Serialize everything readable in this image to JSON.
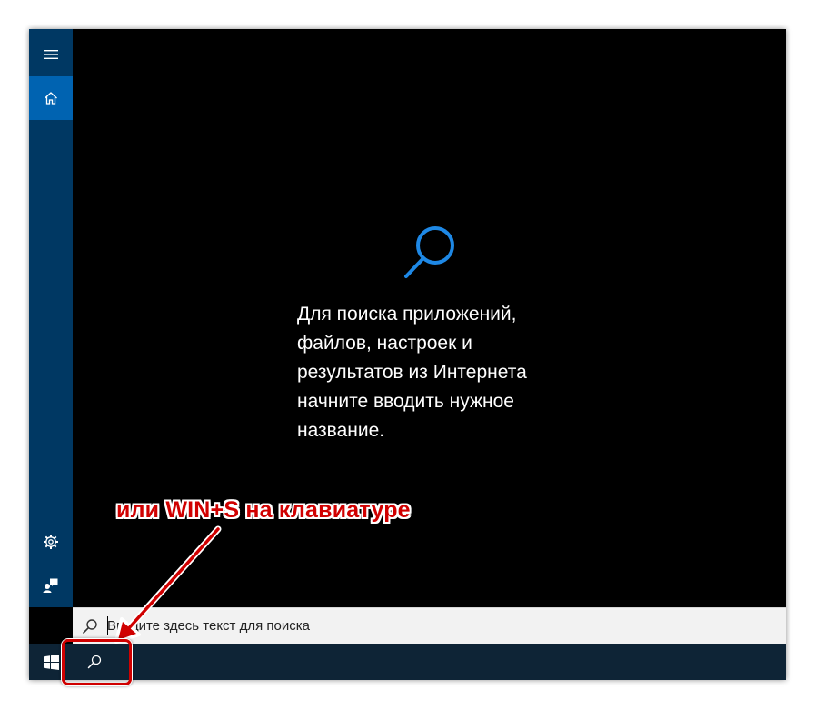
{
  "sidebar": {
    "menu_icon": "hamburger-menu-icon",
    "home_icon": "home-icon",
    "settings_icon": "gear-icon",
    "feedback_icon": "feedback-icon"
  },
  "content": {
    "hero_icon": "search-icon",
    "hint_lines": [
      "Для поиска приложений,",
      "файлов, настроек и",
      "результатов из Интернета",
      "начните вводить нужное",
      "название."
    ]
  },
  "search_box": {
    "placeholder": "Введите здесь текст для поиска",
    "icon": "search-icon"
  },
  "taskbar": {
    "start_icon": "windows-logo-icon",
    "search_icon": "search-icon"
  },
  "annotation": {
    "text": "или WIN+S на клавиатуре",
    "color": "#d00000"
  },
  "colors": {
    "accent": "#0063b1",
    "sidebar": "#003863",
    "taskbar": "#0e2436",
    "hero_icon": "#1e88e5"
  }
}
